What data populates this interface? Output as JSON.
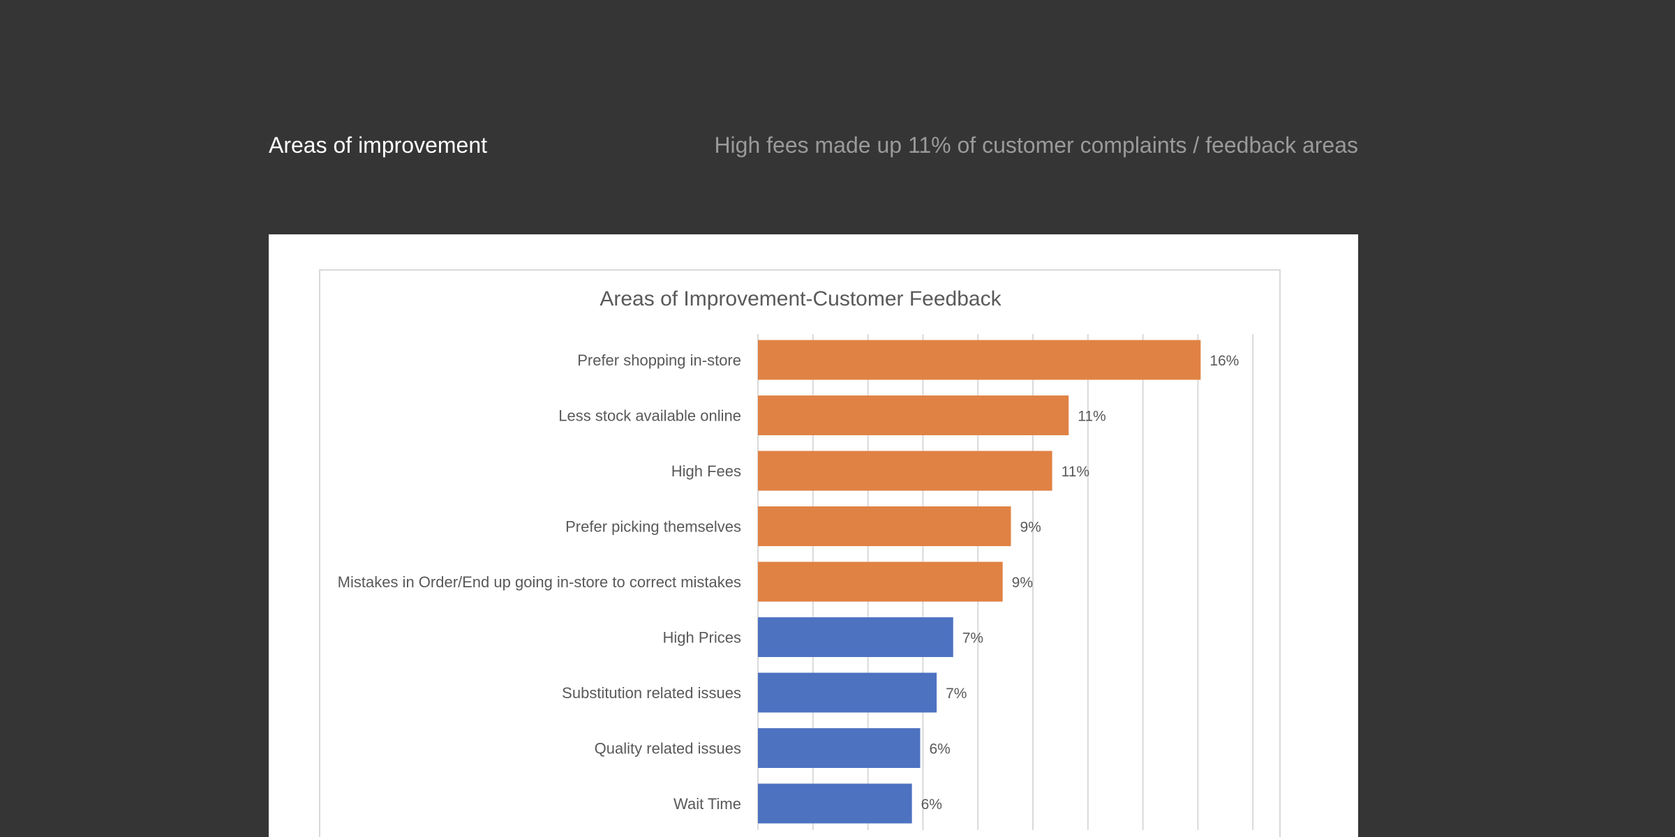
{
  "slide": {
    "title": "Areas of improvement",
    "subtitle": "High fees made up 11% of customer complaints / feedback areas"
  },
  "chart_data": {
    "type": "bar",
    "orientation": "horizontal",
    "title": "Areas of Improvement-Customer  Feedback",
    "xlabel": "",
    "ylabel": "",
    "grid": true,
    "xlim": [
      0,
      18
    ],
    "categories": [
      "Prefer shopping in-store",
      "Less stock available online",
      "High Fees",
      "Prefer picking themselves",
      "Mistakes in Order/End up going in-store to correct mistakes",
      "High Prices",
      "Substitution related issues",
      "Quality related issues",
      "Wait Time"
    ],
    "values": [
      16.1,
      11.3,
      10.7,
      9.2,
      8.9,
      7.1,
      6.5,
      5.9,
      5.6
    ],
    "value_labels": [
      "16%",
      "11%",
      "11%",
      "9%",
      "9%",
      "7%",
      "7%",
      "6%",
      "6%"
    ],
    "highlight_count": 5,
    "colors": {
      "highlight": "#E08244",
      "default": "#4D72C0",
      "grid": "#d9d9d9",
      "text": "#595959"
    }
  }
}
